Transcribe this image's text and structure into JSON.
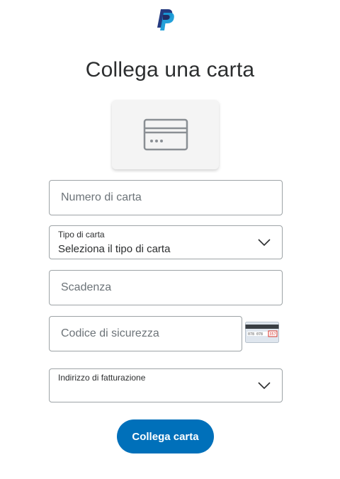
{
  "brand": {
    "logo_icon": "paypal-logo",
    "accent": "#0070ba"
  },
  "page": {
    "title": "Collega una carta"
  },
  "illustration": {
    "icon": "credit-card-icon"
  },
  "form": {
    "card_number": {
      "placeholder": "Numero di carta"
    },
    "card_type": {
      "label": "Tipo di carta",
      "value": "Seleziona il tipo di carta",
      "icon": "chevron-down-icon"
    },
    "expiry": {
      "placeholder": "Scadenza"
    },
    "security_code": {
      "placeholder": "Codice di sicurezza",
      "hint_icon": "card-back-cvv-icon",
      "hint_digits_a": "078 078",
      "hint_digits_b": "357"
    },
    "billing_address": {
      "label": "Indirizzo di fatturazione",
      "icon": "chevron-down-icon"
    }
  },
  "actions": {
    "submit_label": "Collega carta"
  }
}
